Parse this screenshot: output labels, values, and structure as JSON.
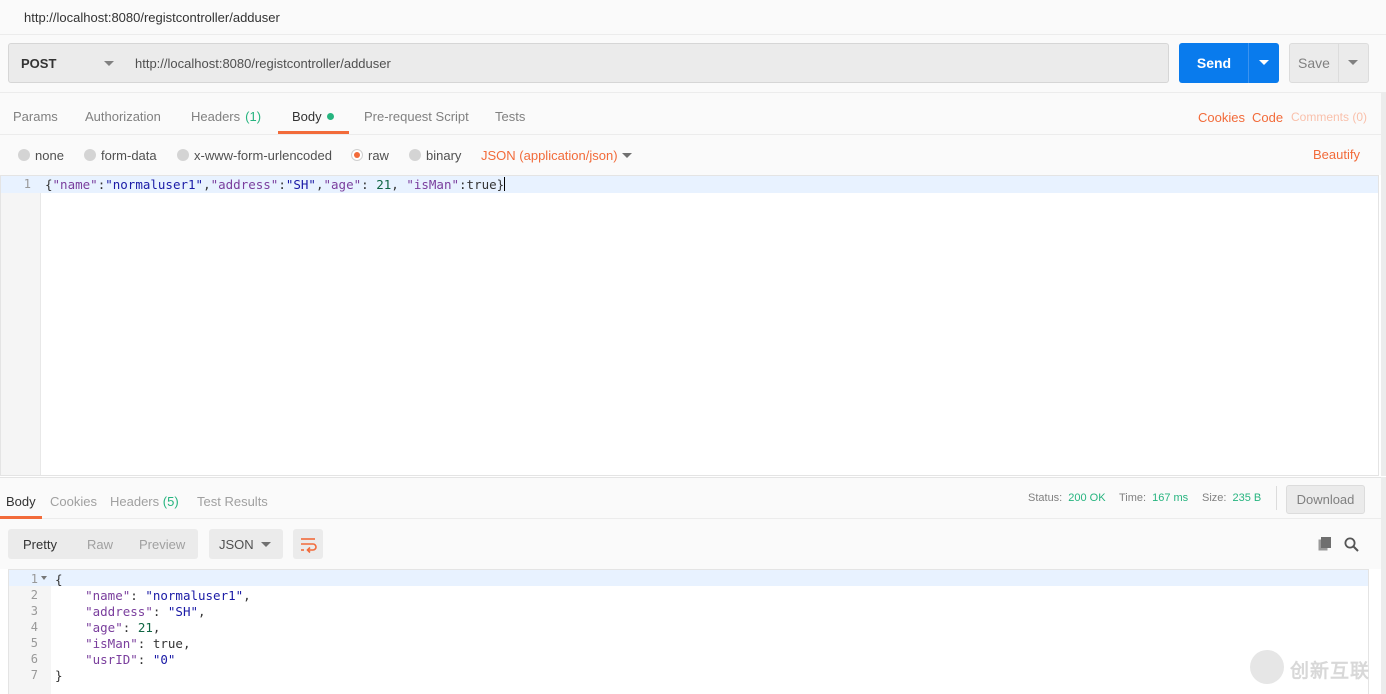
{
  "window": {
    "title": "http://localhost:8080/registcontroller/adduser"
  },
  "request": {
    "method": "POST",
    "url": "http://localhost:8080/registcontroller/adduser",
    "send_label": "Send",
    "save_label": "Save"
  },
  "request_tabs": {
    "params": "Params",
    "authorization": "Authorization",
    "headers": "Headers",
    "headers_count": "(1)",
    "body": "Body",
    "pre_request": "Pre-request Script",
    "tests": "Tests",
    "cookies": "Cookies",
    "code": "Code",
    "comments": "Comments (0)"
  },
  "body_options": {
    "none": "none",
    "form_data": "form-data",
    "urlencoded": "x-www-form-urlencoded",
    "raw": "raw",
    "binary": "binary",
    "selected": "raw",
    "content_type": "JSON (application/json)",
    "beautify": "Beautify"
  },
  "request_body": {
    "line_number": "1",
    "text": "{\"name\":\"normaluser1\",\"address\":\"SH\",\"age\": 21, \"isMan\":true}"
  },
  "response_tabs": {
    "body": "Body",
    "cookies": "Cookies",
    "headers": "Headers",
    "headers_count": "(5)",
    "test_results": "Test Results"
  },
  "response_meta": {
    "status_label": "Status:",
    "status_value": "200 OK",
    "time_label": "Time:",
    "time_value": "167 ms",
    "size_label": "Size:",
    "size_value": "235 B",
    "download_label": "Download"
  },
  "response_view": {
    "pretty": "Pretty",
    "raw": "Raw",
    "preview": "Preview",
    "format": "JSON"
  },
  "response_body": {
    "lines": [
      {
        "num": "1",
        "text": "{"
      },
      {
        "num": "2",
        "text": "    \"name\": \"normaluser1\","
      },
      {
        "num": "3",
        "text": "    \"address\": \"SH\","
      },
      {
        "num": "4",
        "text": "    \"age\": 21,"
      },
      {
        "num": "5",
        "text": "    \"isMan\": true,"
      },
      {
        "num": "6",
        "text": "    \"usrID\": \"0\""
      },
      {
        "num": "7",
        "text": "}"
      }
    ]
  },
  "watermark": {
    "text": "创新互联"
  },
  "colors": {
    "accent_orange": "#f26b3a",
    "send_blue": "#097bed",
    "status_green": "#26b47f"
  }
}
